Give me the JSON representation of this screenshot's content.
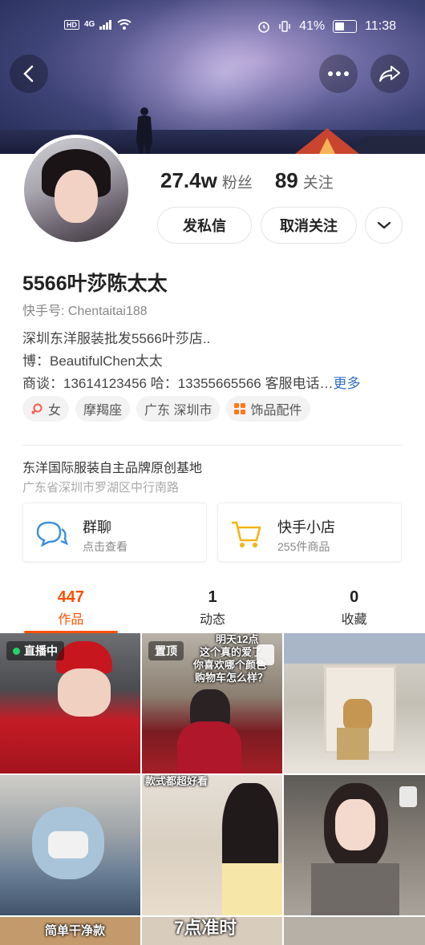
{
  "status_bar": {
    "network_left": "HD",
    "signal_label": "4G",
    "battery_percent": "41%",
    "time": "11:38"
  },
  "profile": {
    "followers_count": "27.4w",
    "followers_label": "粉丝",
    "following_count": "89",
    "following_label": "关注",
    "message_button": "发私信",
    "unfollow_button": "取消关注",
    "name": "5566叶莎陈太太",
    "kuaishou_id": "快手号: Chentaitai188",
    "bio_lines": [
      "深圳东洋服装批发5566叶莎店..",
      "博：BeautifulChen太太",
      "商谈：13614123456 哈：13355665566 客服电话…"
    ],
    "more_label": "更多",
    "tags": [
      "女",
      "摩羯座",
      "广东 深圳市",
      "饰品配件"
    ],
    "org_title": "东洋国际服装自主品牌原创基地",
    "address": "广东省深圳市罗湖区中行南路"
  },
  "shortcuts": {
    "group_chat": {
      "title": "群聊",
      "subtitle": "点击查看"
    },
    "shop": {
      "title": "快手小店",
      "subtitle": "255件商品"
    }
  },
  "tabs": [
    {
      "count": "447",
      "label": "作品",
      "active": true
    },
    {
      "count": "1",
      "label": "动态",
      "active": false
    },
    {
      "count": "0",
      "label": "收藏",
      "active": false
    }
  ],
  "grid": {
    "live_badge": "直播中",
    "pinned_badge": "置顶",
    "cap_2": [
      "明天12点",
      "这个真的爱了",
      "你喜欢哪个颜色",
      "购物车怎么样？"
    ],
    "cap_5": "款式都超好看",
    "cap_7": "简单干净款",
    "cap_8": "7点准时"
  },
  "colors": {
    "accent": "#ff5000",
    "link": "#2f6fc7",
    "live_dot": "#25d26a"
  }
}
